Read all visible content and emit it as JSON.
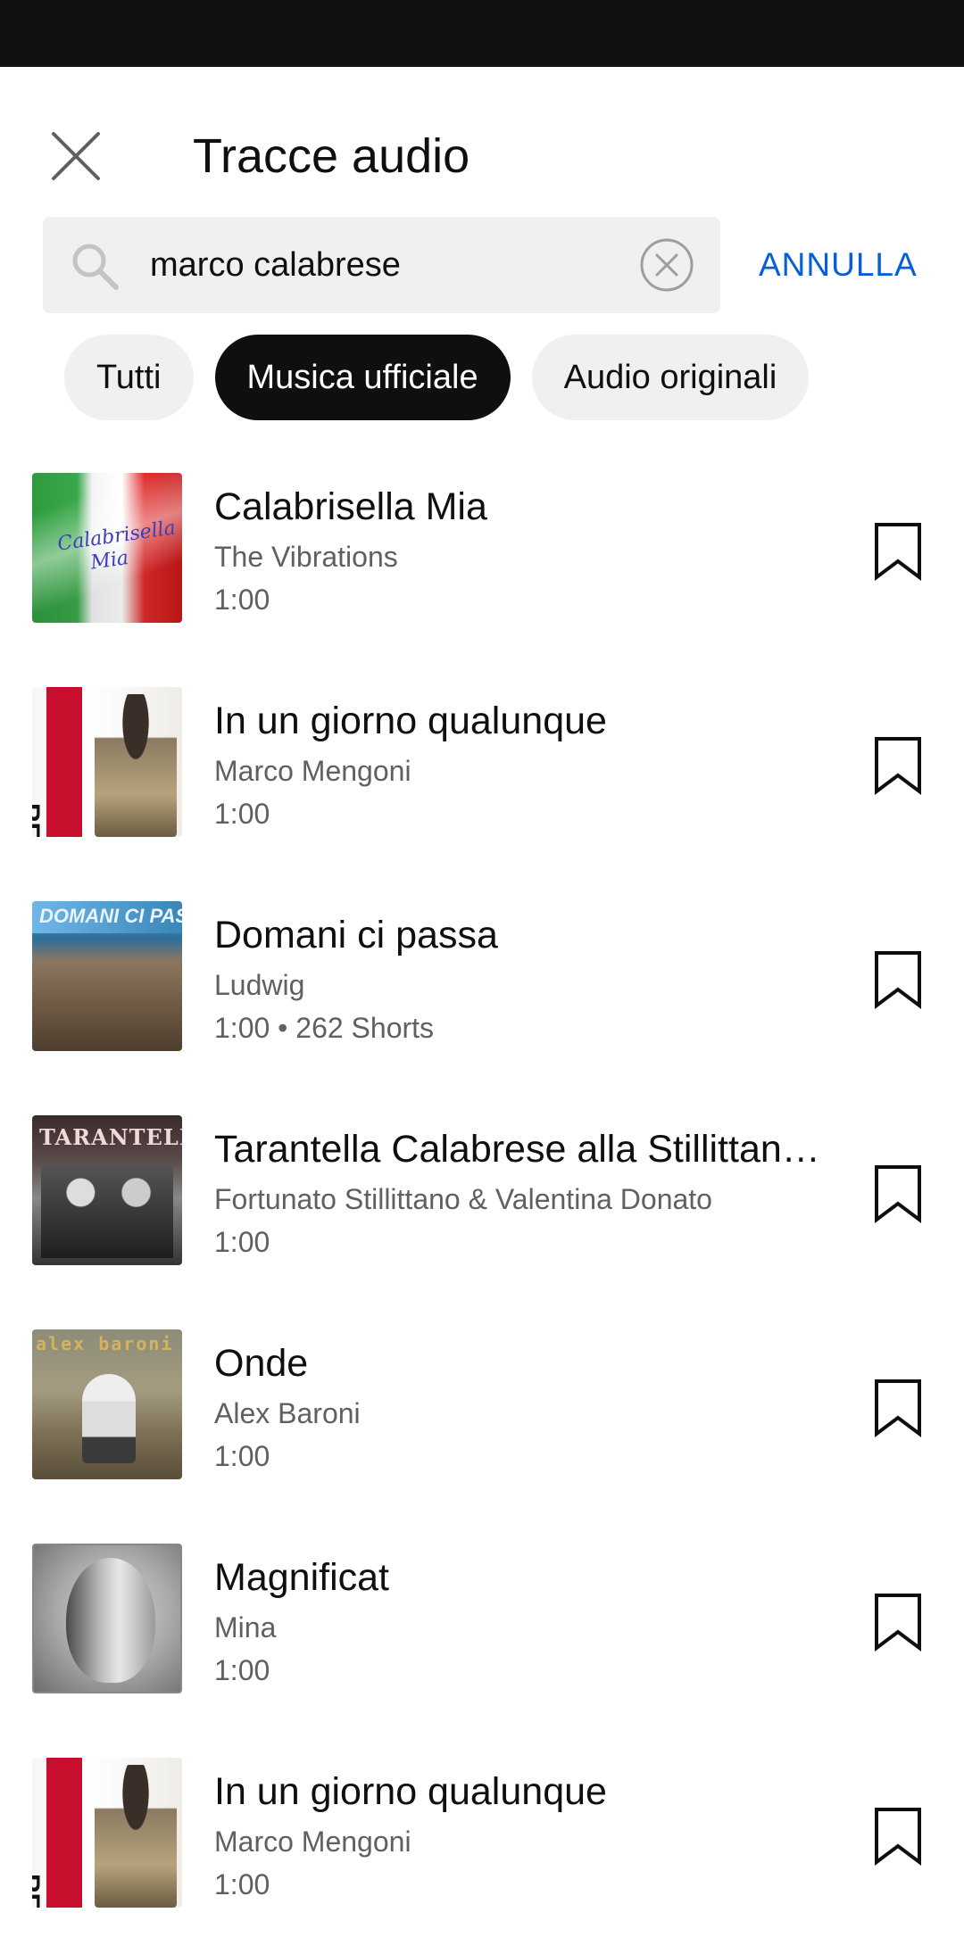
{
  "header": {
    "title": "Tracce audio"
  },
  "search": {
    "value": "marco calabrese",
    "cancel_label": "ANNULLA"
  },
  "chips": [
    {
      "label": "Tutti",
      "active": false
    },
    {
      "label": "Musica ufficiale",
      "active": true
    },
    {
      "label": "Audio originali",
      "active": false
    }
  ],
  "tracks": [
    {
      "title": "Calabrisella Mia",
      "artist": "The Vibrations",
      "meta": "1:00",
      "art": "art-flag",
      "art_text": "Calabrisella Mia"
    },
    {
      "title": "In un giorno qualunque",
      "artist": "Marco Mengoni",
      "meta": "1:00",
      "art": "art-mengoni",
      "art_text": "RE MATTO"
    },
    {
      "title": "Domani ci passa",
      "artist": "Ludwig",
      "meta": "1:00 • 262 Shorts",
      "art": "art-ludwig",
      "art_text": "DOMANI CI PASSA"
    },
    {
      "title": "Tarantella Calabrese alla Stillittano…",
      "artist": "Fortunato Stillittano & Valentina Donato",
      "meta": "1:00",
      "art": "art-tarantella",
      "art_text": "TARANTELLA"
    },
    {
      "title": "Onde",
      "artist": "Alex Baroni",
      "meta": "1:00",
      "art": "art-baroni",
      "art_text": "alex baroni"
    },
    {
      "title": "Magnificat",
      "artist": "Mina",
      "meta": "1:00",
      "art": "art-mina",
      "art_text": ""
    },
    {
      "title": "In un giorno qualunque",
      "artist": "Marco Mengoni",
      "meta": "1:00",
      "art": "art-mengoni",
      "art_text": "RE MATTO"
    }
  ],
  "colors": {
    "accent": "#065fd4",
    "chip_active_bg": "#0f0f0f",
    "chip_bg": "#f0f0f0",
    "secondary_text": "#606060"
  },
  "icons": {
    "close": "close-icon",
    "search": "search-icon",
    "clear": "clear-circle-icon",
    "bookmark": "bookmark-outline-icon"
  }
}
